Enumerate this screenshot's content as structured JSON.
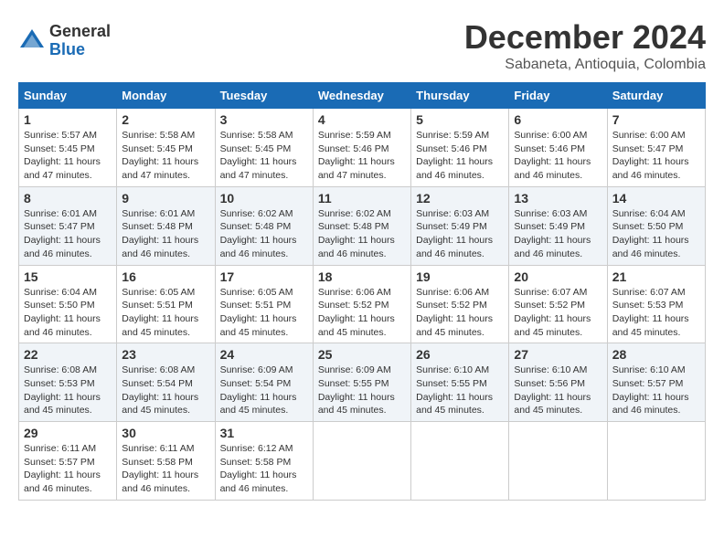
{
  "logo": {
    "general": "General",
    "blue": "Blue"
  },
  "title": "December 2024",
  "location": "Sabaneta, Antioquia, Colombia",
  "days_of_week": [
    "Sunday",
    "Monday",
    "Tuesday",
    "Wednesday",
    "Thursday",
    "Friday",
    "Saturday"
  ],
  "weeks": [
    [
      {
        "day": "1",
        "info": "Sunrise: 5:57 AM\nSunset: 5:45 PM\nDaylight: 11 hours\nand 47 minutes."
      },
      {
        "day": "2",
        "info": "Sunrise: 5:58 AM\nSunset: 5:45 PM\nDaylight: 11 hours\nand 47 minutes."
      },
      {
        "day": "3",
        "info": "Sunrise: 5:58 AM\nSunset: 5:45 PM\nDaylight: 11 hours\nand 47 minutes."
      },
      {
        "day": "4",
        "info": "Sunrise: 5:59 AM\nSunset: 5:46 PM\nDaylight: 11 hours\nand 47 minutes."
      },
      {
        "day": "5",
        "info": "Sunrise: 5:59 AM\nSunset: 5:46 PM\nDaylight: 11 hours\nand 46 minutes."
      },
      {
        "day": "6",
        "info": "Sunrise: 6:00 AM\nSunset: 5:46 PM\nDaylight: 11 hours\nand 46 minutes."
      },
      {
        "day": "7",
        "info": "Sunrise: 6:00 AM\nSunset: 5:47 PM\nDaylight: 11 hours\nand 46 minutes."
      }
    ],
    [
      {
        "day": "8",
        "info": "Sunrise: 6:01 AM\nSunset: 5:47 PM\nDaylight: 11 hours\nand 46 minutes."
      },
      {
        "day": "9",
        "info": "Sunrise: 6:01 AM\nSunset: 5:48 PM\nDaylight: 11 hours\nand 46 minutes."
      },
      {
        "day": "10",
        "info": "Sunrise: 6:02 AM\nSunset: 5:48 PM\nDaylight: 11 hours\nand 46 minutes."
      },
      {
        "day": "11",
        "info": "Sunrise: 6:02 AM\nSunset: 5:48 PM\nDaylight: 11 hours\nand 46 minutes."
      },
      {
        "day": "12",
        "info": "Sunrise: 6:03 AM\nSunset: 5:49 PM\nDaylight: 11 hours\nand 46 minutes."
      },
      {
        "day": "13",
        "info": "Sunrise: 6:03 AM\nSunset: 5:49 PM\nDaylight: 11 hours\nand 46 minutes."
      },
      {
        "day": "14",
        "info": "Sunrise: 6:04 AM\nSunset: 5:50 PM\nDaylight: 11 hours\nand 46 minutes."
      }
    ],
    [
      {
        "day": "15",
        "info": "Sunrise: 6:04 AM\nSunset: 5:50 PM\nDaylight: 11 hours\nand 46 minutes."
      },
      {
        "day": "16",
        "info": "Sunrise: 6:05 AM\nSunset: 5:51 PM\nDaylight: 11 hours\nand 45 minutes."
      },
      {
        "day": "17",
        "info": "Sunrise: 6:05 AM\nSunset: 5:51 PM\nDaylight: 11 hours\nand 45 minutes."
      },
      {
        "day": "18",
        "info": "Sunrise: 6:06 AM\nSunset: 5:52 PM\nDaylight: 11 hours\nand 45 minutes."
      },
      {
        "day": "19",
        "info": "Sunrise: 6:06 AM\nSunset: 5:52 PM\nDaylight: 11 hours\nand 45 minutes."
      },
      {
        "day": "20",
        "info": "Sunrise: 6:07 AM\nSunset: 5:52 PM\nDaylight: 11 hours\nand 45 minutes."
      },
      {
        "day": "21",
        "info": "Sunrise: 6:07 AM\nSunset: 5:53 PM\nDaylight: 11 hours\nand 45 minutes."
      }
    ],
    [
      {
        "day": "22",
        "info": "Sunrise: 6:08 AM\nSunset: 5:53 PM\nDaylight: 11 hours\nand 45 minutes."
      },
      {
        "day": "23",
        "info": "Sunrise: 6:08 AM\nSunset: 5:54 PM\nDaylight: 11 hours\nand 45 minutes."
      },
      {
        "day": "24",
        "info": "Sunrise: 6:09 AM\nSunset: 5:54 PM\nDaylight: 11 hours\nand 45 minutes."
      },
      {
        "day": "25",
        "info": "Sunrise: 6:09 AM\nSunset: 5:55 PM\nDaylight: 11 hours\nand 45 minutes."
      },
      {
        "day": "26",
        "info": "Sunrise: 6:10 AM\nSunset: 5:55 PM\nDaylight: 11 hours\nand 45 minutes."
      },
      {
        "day": "27",
        "info": "Sunrise: 6:10 AM\nSunset: 5:56 PM\nDaylight: 11 hours\nand 45 minutes."
      },
      {
        "day": "28",
        "info": "Sunrise: 6:10 AM\nSunset: 5:57 PM\nDaylight: 11 hours\nand 46 minutes."
      }
    ],
    [
      {
        "day": "29",
        "info": "Sunrise: 6:11 AM\nSunset: 5:57 PM\nDaylight: 11 hours\nand 46 minutes."
      },
      {
        "day": "30",
        "info": "Sunrise: 6:11 AM\nSunset: 5:58 PM\nDaylight: 11 hours\nand 46 minutes."
      },
      {
        "day": "31",
        "info": "Sunrise: 6:12 AM\nSunset: 5:58 PM\nDaylight: 11 hours\nand 46 minutes."
      },
      {
        "day": "",
        "info": ""
      },
      {
        "day": "",
        "info": ""
      },
      {
        "day": "",
        "info": ""
      },
      {
        "day": "",
        "info": ""
      }
    ]
  ]
}
